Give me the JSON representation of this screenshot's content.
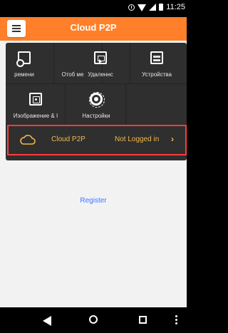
{
  "status_bar": {
    "time": "11:25",
    "icons": [
      "alarm-icon",
      "wifi-icon",
      "signal-icon",
      "battery-icon"
    ]
  },
  "app_bar": {
    "title": "Cloud P2P",
    "menu_icon": "menu-icon"
  },
  "menu_grid": {
    "items": [
      {
        "label": "ремени",
        "icon": "monitor-icon"
      },
      {
        "label": "Отоб ме",
        "icon": "video-icon"
      },
      {
        "label": "Удаленнс",
        "icon": "video-icon"
      },
      {
        "label": "Устройства",
        "icon": "storage-icon"
      },
      {
        "label": "Изображение & I",
        "icon": "photos-icon"
      },
      {
        "label": "Настройки",
        "icon": "gear-icon"
      }
    ]
  },
  "cloud_row": {
    "name": "Cloud P2P",
    "status": "Not Logged in",
    "icon": "cloud-icon",
    "chevron": "chevron-right-icon"
  },
  "register": {
    "label": "Register"
  },
  "colors": {
    "app_bar": "#ff7f2a",
    "accent_text": "#f2b84b",
    "highlight_border": "#ff3b3b",
    "link": "#3b77ff"
  },
  "navigation_bar": {
    "buttons": [
      "back",
      "home",
      "recent",
      "more"
    ]
  }
}
